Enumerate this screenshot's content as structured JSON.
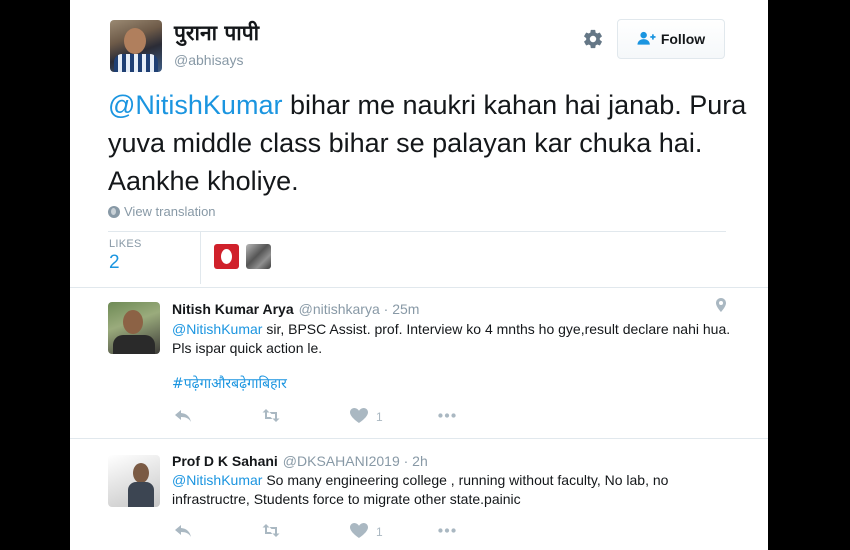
{
  "tweet": {
    "author_name": "पुराना पापी",
    "author_handle": "@abhisays",
    "follow_label": "Follow",
    "text_mention": "@NitishKumar",
    "text_body": " bihar me naukri kahan hai janab. Pura yuva middle class bihar se palayan kar chuka hai. Aankhe kholiye.",
    "translate_label": "View translation",
    "likes_label": "LIKES",
    "likes_count": "2"
  },
  "replies": [
    {
      "name": "Nitish Kumar Arya",
      "handle": "@nitishkarya",
      "time": "· 25m",
      "mention": "@NitishKumar",
      "text": " sir, BPSC Assist. prof. Interview ko 4 mnths ho gye,result declare nahi hua. Pls ispar quick action le.",
      "hashtag": "#पढ़ेगाऔरबढ़ेगाबिहार",
      "likes": "1"
    },
    {
      "name": "Prof D K Sahani",
      "handle": "@DKSAHANI2019",
      "time": "· 2h",
      "mention": "@NitishKumar",
      "text": " So many engineering college , running without faculty, No lab, no infrastructre, Students force to migrate other state.painic",
      "likes": "1"
    }
  ],
  "icons": {
    "gear": "gear-icon",
    "follow": "person-plus-icon",
    "globe": "globe-icon",
    "pin": "location-pin-icon",
    "reply": "reply-icon",
    "retweet": "retweet-icon",
    "like": "heart-icon",
    "more": "more-icon"
  },
  "colors": {
    "link": "#1b95e0",
    "muted": "#8899a6",
    "text": "#14171a"
  }
}
